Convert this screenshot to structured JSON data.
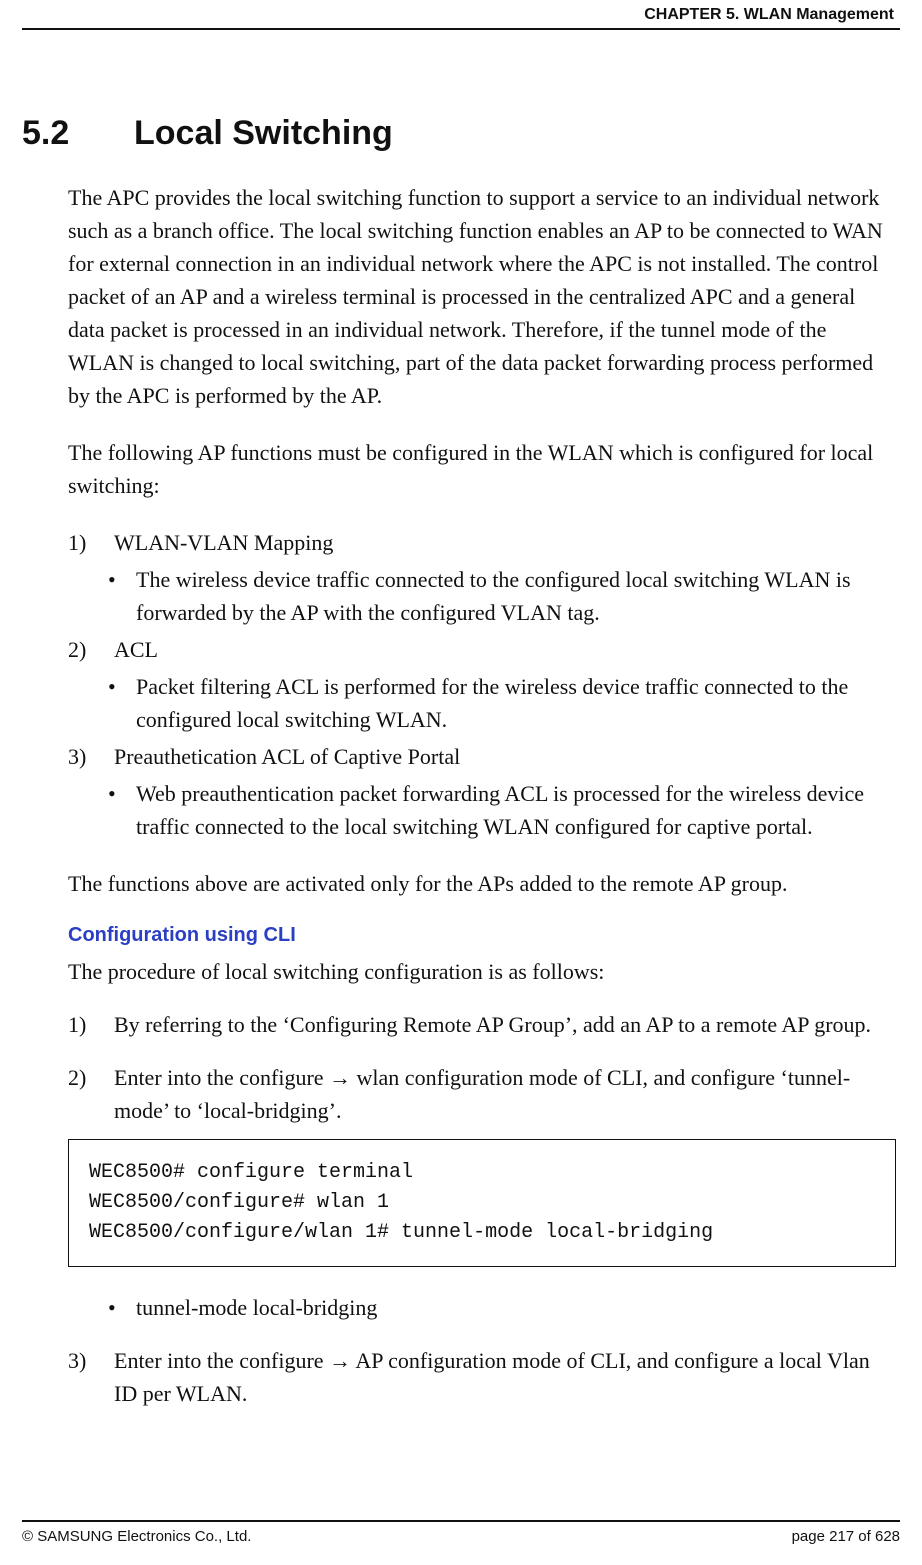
{
  "header": {
    "chapter": "CHAPTER 5. WLAN Management"
  },
  "section": {
    "number": "5.2",
    "title": "Local Switching"
  },
  "paras": {
    "intro": "The APC provides the local switching function to support a service to an individual network such as a branch office. The local switching function enables an AP to be connected to WAN for external connection in an individual network where the APC is not installed. The control packet of an AP and a wireless terminal is processed in the centralized APC and a general data packet is processed in an individual network. Therefore, if the tunnel mode of the WLAN is changed to local switching, part of the data packet forwarding process performed by the APC is performed by the AP.",
    "follow": "The following AP functions must be configured in the WLAN which is configured for local switching:",
    "activated": "The functions above are activated only for the APs added to the remote AP group.",
    "cli_intro": "The procedure of local switching configuration is as follows:"
  },
  "func_list": [
    {
      "num": "1)",
      "label": "WLAN-VLAN Mapping",
      "sub": "The wireless device traffic connected to the configured local switching WLAN is forwarded by the AP with the configured VLAN tag."
    },
    {
      "num": "2)",
      "label": "ACL",
      "sub": "Packet filtering ACL is performed for the wireless device traffic connected to the configured local switching WLAN."
    },
    {
      "num": "3)",
      "label": "Preauthetication ACL of Captive Portal",
      "sub": "Web preauthentication packet forwarding ACL is processed for the wireless device traffic connected to the local switching WLAN configured for captive portal."
    }
  ],
  "subhead": "Configuration using CLI",
  "steps": {
    "s1_num": "1)",
    "s1_text": "By referring to the ‘Configuring Remote AP Group’, add an AP to a remote AP group.",
    "s2_num": "2)",
    "s2_pre": "Enter into the configure ",
    "arrow": "→",
    "s2_post": " wlan configuration mode of CLI, and configure ‘tunnel-mode’ to ‘local-bridging’.",
    "s2_bullet": "tunnel-mode  local-bridging",
    "s3_num": "3)",
    "s3_pre": "Enter into the configure ",
    "s3_post": " AP configuration mode of CLI, and configure a local Vlan ID per WLAN."
  },
  "cli": "WEC8500# configure terminal\nWEC8500/configure# wlan 1\nWEC8500/configure/wlan 1# tunnel-mode local-bridging",
  "footer": {
    "copyright": "© SAMSUNG Electronics Co., Ltd.",
    "page_label": "page 217 of 628"
  }
}
